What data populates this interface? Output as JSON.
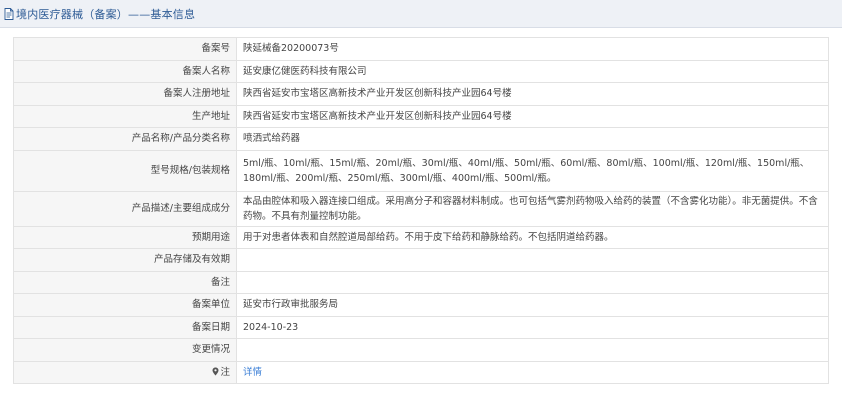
{
  "header": {
    "title": "境内医疗器械（备案）——基本信息",
    "icon": "document-icon"
  },
  "rows": [
    {
      "label": "备案号",
      "value": "陕延械备20200073号"
    },
    {
      "label": "备案人名称",
      "value": "延安康亿健医药科技有限公司"
    },
    {
      "label": "备案人注册地址",
      "value": "陕西省延安市宝塔区高新技术产业开发区创新科技产业园64号楼"
    },
    {
      "label": "生产地址",
      "value": "陕西省延安市宝塔区高新技术产业开发区创新科技产业园64号楼"
    },
    {
      "label": "产品名称/产品分类名称",
      "value": "喷洒式给药器"
    },
    {
      "label": "型号规格/包装规格",
      "value": "5ml/瓶、10ml/瓶、15ml/瓶、20ml/瓶、30ml/瓶、40ml/瓶、50ml/瓶、60ml/瓶、80ml/瓶、100ml/瓶、120ml/瓶、150ml/瓶、180ml/瓶、200ml/瓶、250ml/瓶、300ml/瓶、400ml/瓶、500ml/瓶。"
    },
    {
      "label": "产品描述/主要组成成分",
      "value": "本品由腔体和吸入器连接口组成。采用高分子和容器材料制成。也可包括气雾剂药物吸入给药的装置（不含雾化功能）。非无菌提供。不含药物。不具有剂量控制功能。"
    },
    {
      "label": "预期用途",
      "value": "用于对患者体表和自然腔道局部给药。不用于皮下给药和静脉给药。不包括阴道给药器。"
    },
    {
      "label": "产品存储及有效期",
      "value": ""
    },
    {
      "label": "备注",
      "value": ""
    },
    {
      "label": "备案单位",
      "value": "延安市行政审批服务局"
    },
    {
      "label": "备案日期",
      "value": "2024-10-23"
    },
    {
      "label": "变更情况",
      "value": ""
    },
    {
      "label": "注",
      "value": "详情",
      "icon": "pin-icon"
    }
  ],
  "colors": {
    "header_bg": "#eef1f6",
    "header_text": "#2d5b95",
    "label_bg": "#f6f6f6",
    "link": "#3a7ed6",
    "border": "#e2e2e2"
  }
}
